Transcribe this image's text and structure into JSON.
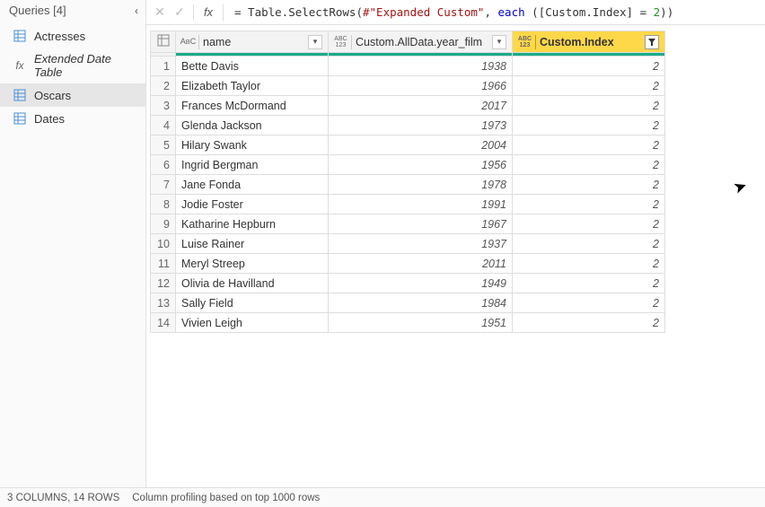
{
  "sidebar": {
    "title": "Queries [4]",
    "items": [
      {
        "label": "Actresses",
        "icon": "table"
      },
      {
        "label": "Extended Date Table",
        "icon": "fx"
      },
      {
        "label": "Oscars",
        "icon": "table"
      },
      {
        "label": "Dates",
        "icon": "table"
      }
    ]
  },
  "formula": {
    "prefix": "= Table.SelectRows(",
    "string_arg": "#\"Expanded Custom\"",
    "sep": ", ",
    "keyword": "each",
    "space": " ",
    "open": "([Custom.Index] = ",
    "number": "2",
    "close": "))"
  },
  "columns": [
    {
      "key": "name",
      "label": "name",
      "type": "ABC",
      "filtered": false
    },
    {
      "key": "year",
      "label": "Custom.AllData.year_film",
      "type": "ABC123",
      "filtered": false
    },
    {
      "key": "index",
      "label": "Custom.Index",
      "type": "ABC123",
      "filtered": true
    }
  ],
  "rows": [
    {
      "n": "1",
      "name": "Bette Davis",
      "year": "1938",
      "index": "2"
    },
    {
      "n": "2",
      "name": "Elizabeth Taylor",
      "year": "1966",
      "index": "2"
    },
    {
      "n": "3",
      "name": "Frances McDormand",
      "year": "2017",
      "index": "2"
    },
    {
      "n": "4",
      "name": "Glenda Jackson",
      "year": "1973",
      "index": "2"
    },
    {
      "n": "5",
      "name": "Hilary Swank",
      "year": "2004",
      "index": "2"
    },
    {
      "n": "6",
      "name": "Ingrid Bergman",
      "year": "1956",
      "index": "2"
    },
    {
      "n": "7",
      "name": "Jane Fonda",
      "year": "1978",
      "index": "2"
    },
    {
      "n": "8",
      "name": "Jodie Foster",
      "year": "1991",
      "index": "2"
    },
    {
      "n": "9",
      "name": "Katharine Hepburn",
      "year": "1967",
      "index": "2"
    },
    {
      "n": "10",
      "name": "Luise Rainer",
      "year": "1937",
      "index": "2"
    },
    {
      "n": "11",
      "name": "Meryl Streep",
      "year": "2011",
      "index": "2"
    },
    {
      "n": "12",
      "name": "Olivia de Havilland",
      "year": "1949",
      "index": "2"
    },
    {
      "n": "13",
      "name": "Sally Field",
      "year": "1984",
      "index": "2"
    },
    {
      "n": "14",
      "name": "Vivien Leigh",
      "year": "1951",
      "index": "2"
    }
  ],
  "status": {
    "summary": "3 COLUMNS, 14 ROWS",
    "profiling": "Column profiling based on top 1000 rows"
  }
}
